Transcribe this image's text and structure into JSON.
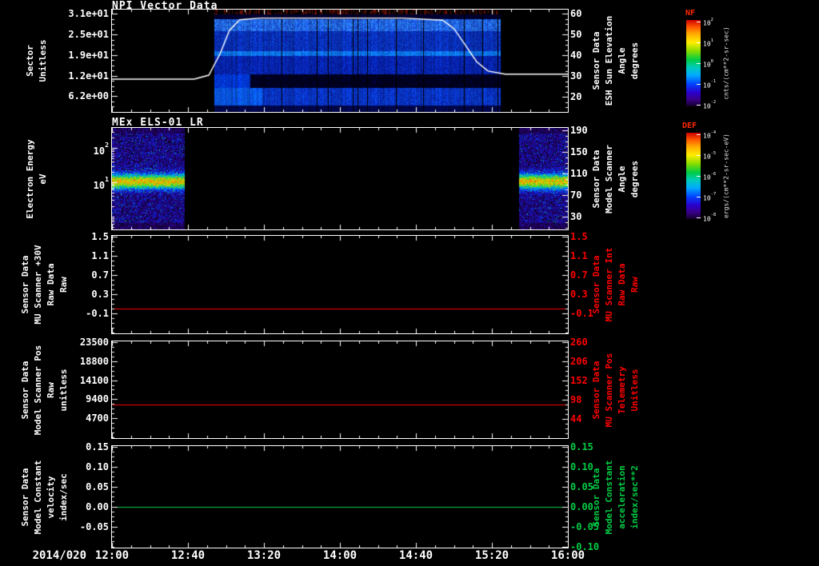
{
  "window": {
    "background": "#000000"
  },
  "x_axis": {
    "date_label": "2014/020",
    "tick_labels": [
      "12:00",
      "12:40",
      "13:20",
      "14:00",
      "14:40",
      "15:20",
      "16:00"
    ],
    "tick_hours": [
      12,
      12.6667,
      13.3333,
      14,
      14.6667,
      15.3333,
      16
    ],
    "range_hours": [
      12,
      16
    ]
  },
  "chart_data": [
    {
      "type": "heatmap",
      "title": "NPI Vector Data",
      "y_left": {
        "label_lines": [
          "Sector",
          "Unitless"
        ],
        "scale": "linear",
        "ylim": [
          1.5,
          32.3
        ],
        "ticks": [
          {
            "label": "3.1e+01",
            "value": 31
          },
          {
            "label": "2.5e+01",
            "value": 24.8
          },
          {
            "label": "1.9e+01",
            "value": 18.6
          },
          {
            "label": "1.2e+01",
            "value": 12.4
          },
          {
            "label": "6.2e+00",
            "value": 6.2
          }
        ]
      },
      "y_right": {
        "label_lines": [
          "Sensor Data",
          "ESH Sun Elevation",
          "Angle",
          "degrees"
        ],
        "color": "#ffffff",
        "scale": "linear",
        "ylim": [
          12.8,
          62.1
        ],
        "ticks": [
          {
            "label": "60",
            "value": 60
          },
          {
            "label": "50",
            "value": 50
          },
          {
            "label": "40",
            "value": 40
          },
          {
            "label": "30",
            "value": 30
          },
          {
            "label": "20",
            "value": 20
          }
        ]
      },
      "heatmap": {
        "kind": "npi",
        "t_start": 12.9,
        "t_end": 15.4,
        "note": "blue sector spectrogram, dark gap band near sector 10, sparse dark-red speckle at top sectors, data absent before 12:54 and after 15:24"
      },
      "overlay_series": {
        "name": "ESH Sun Elevation Angle",
        "color": "#ffffff",
        "axis": "right",
        "points": [
          [
            12.0,
            28.6
          ],
          [
            12.72,
            28.6
          ],
          [
            12.85,
            30.5
          ],
          [
            12.95,
            41.0
          ],
          [
            13.03,
            52.0
          ],
          [
            13.12,
            57.2
          ],
          [
            13.3,
            58.0
          ],
          [
            14.55,
            58.0
          ],
          [
            14.9,
            57.0
          ],
          [
            15.0,
            53.0
          ],
          [
            15.1,
            45.0
          ],
          [
            15.2,
            37.0
          ],
          [
            15.3,
            32.5
          ],
          [
            15.45,
            31.0
          ],
          [
            16.0,
            31.0
          ]
        ]
      }
    },
    {
      "type": "heatmap",
      "title": "MEx ELS-01 LR",
      "y_left": {
        "label_lines": [
          "Electron Energy",
          "eV"
        ],
        "scale": "log",
        "ylim": [
          0.42,
          385
        ],
        "ticks": [
          {
            "label": "10^2",
            "value": 100
          },
          {
            "label": "10^1",
            "value": 10
          }
        ]
      },
      "y_right": {
        "label_lines": [
          "Sensor Data",
          "Model Scanner",
          "Angle",
          "degrees"
        ],
        "color": "#ffffff",
        "scale": "linear",
        "ylim": [
          6.3,
          194.5
        ],
        "ticks": [
          {
            "label": "190",
            "value": 190
          },
          {
            "label": "150",
            "value": 150
          },
          {
            "label": "110",
            "value": 110
          },
          {
            "label": "70",
            "value": 70
          },
          {
            "label": "30",
            "value": 30
          }
        ]
      },
      "heatmap": {
        "kind": "els",
        "segments": [
          [
            12.0,
            12.63
          ],
          [
            15.57,
            16.0
          ]
        ],
        "band_center_ev": 11,
        "note": "noisy blue spectrogram with bright green-yellow band near 10 eV; data gap between 12:38 and 15:34"
      }
    },
    {
      "type": "line",
      "title": "",
      "y_left": {
        "label_lines": [
          "Sensor Data",
          "MU Scanner +30V",
          "Raw Data",
          "Raw"
        ],
        "scale": "linear",
        "ylim": [
          -0.51,
          1.52
        ],
        "ticks": [
          {
            "label": "1.5",
            "value": 1.5
          },
          {
            "label": "1.1",
            "value": 1.1
          },
          {
            "label": "0.7",
            "value": 0.7
          },
          {
            "label": "0.3",
            "value": 0.3
          },
          {
            "label": "-0.1",
            "value": -0.1
          }
        ]
      },
      "y_right": {
        "label_lines": [
          "Sensor Data",
          "MU Scanner Int",
          "Raw Data",
          "Raw"
        ],
        "color": "#ff0000",
        "scale": "linear",
        "ylim": [
          -0.51,
          1.52
        ],
        "ticks": [
          {
            "label": "1.5",
            "value": 1.5
          },
          {
            "label": "1.1",
            "value": 1.1
          },
          {
            "label": "0.7",
            "value": 0.7
          },
          {
            "label": "0.3",
            "value": 0.3
          },
          {
            "label": "-0.1",
            "value": -0.1
          }
        ]
      },
      "series": [
        {
          "name": "MU Scanner +30V Raw Data",
          "color": "#ff0000",
          "constant_value": 0.0,
          "axis": "left"
        }
      ]
    },
    {
      "type": "line",
      "title": "",
      "y_left": {
        "label_lines": [
          "Sensor Data",
          "Model Scanner Pos",
          "Raw",
          "unitless"
        ],
        "scale": "linear",
        "ylim": [
          -200,
          23690
        ],
        "ticks": [
          {
            "label": "23500",
            "value": 23500
          },
          {
            "label": "18800",
            "value": 18800
          },
          {
            "label": "14100",
            "value": 14100
          },
          {
            "label": "9400",
            "value": 9400
          },
          {
            "label": "4700",
            "value": 4700
          }
        ]
      },
      "y_right": {
        "label_lines": [
          "Sensor Data",
          "MU Scanner Pos",
          "Telemetry",
          "Unitless"
        ],
        "color": "#ff0000",
        "scale": "linear",
        "ylim": [
          -10.6,
          262
        ],
        "ticks": [
          {
            "label": "260",
            "value": 260
          },
          {
            "label": "206",
            "value": 206
          },
          {
            "label": "152",
            "value": 152
          },
          {
            "label": "98",
            "value": 98
          },
          {
            "label": "44",
            "value": 44
          }
        ]
      },
      "series": [
        {
          "name": "Model Scanner Pos Raw",
          "color": "#ff0000",
          "constant_value": 8000,
          "axis": "left"
        }
      ]
    },
    {
      "type": "line",
      "title": "",
      "y_left": {
        "label_lines": [
          "Sensor Data",
          "Model Constant",
          "velocity",
          "index/sec"
        ],
        "scale": "linear",
        "ylim": [
          -0.1025,
          0.1515
        ],
        "ticks": [
          {
            "label": "0.15",
            "value": 0.15
          },
          {
            "label": "0.10",
            "value": 0.1
          },
          {
            "label": "0.05",
            "value": 0.05
          },
          {
            "label": "0.00",
            "value": 0.0
          },
          {
            "label": "-0.05",
            "value": -0.05
          }
        ]
      },
      "y_right": {
        "label_lines": [
          "Sensor Data",
          "Model Constant",
          "acceleration",
          "index/sec**2"
        ],
        "color": "#00cc44",
        "scale": "linear",
        "ylim": [
          -0.1025,
          0.1515
        ],
        "ticks": [
          {
            "label": "0.15",
            "value": 0.15
          },
          {
            "label": "0.10",
            "value": 0.1
          },
          {
            "label": "0.05",
            "value": 0.05
          },
          {
            "label": "0.00",
            "value": 0.0
          },
          {
            "label": "-0.05",
            "value": -0.05
          },
          {
            "label": "-0.10",
            "value": -0.1
          }
        ]
      },
      "series": [
        {
          "name": "Model Constant velocity",
          "color": "#00cc44",
          "constant_value": 0.0,
          "axis": "left"
        }
      ]
    }
  ],
  "colorbars": [
    {
      "title": "NF",
      "title_color": "#ff2a00",
      "unit": "cnts/(cm**2-sr-sec)",
      "tick_labels": [
        "10^2",
        "10^1",
        "10^0",
        "10^-1",
        "10^-2"
      ]
    },
    {
      "title": "DEF",
      "title_color": "#ff2a00",
      "unit": "ergs/(cm**2-sr-sec-eV)",
      "tick_labels": [
        "10^-4",
        "10^-5",
        "10^-6",
        "10^-7",
        "10^-8"
      ]
    }
  ]
}
